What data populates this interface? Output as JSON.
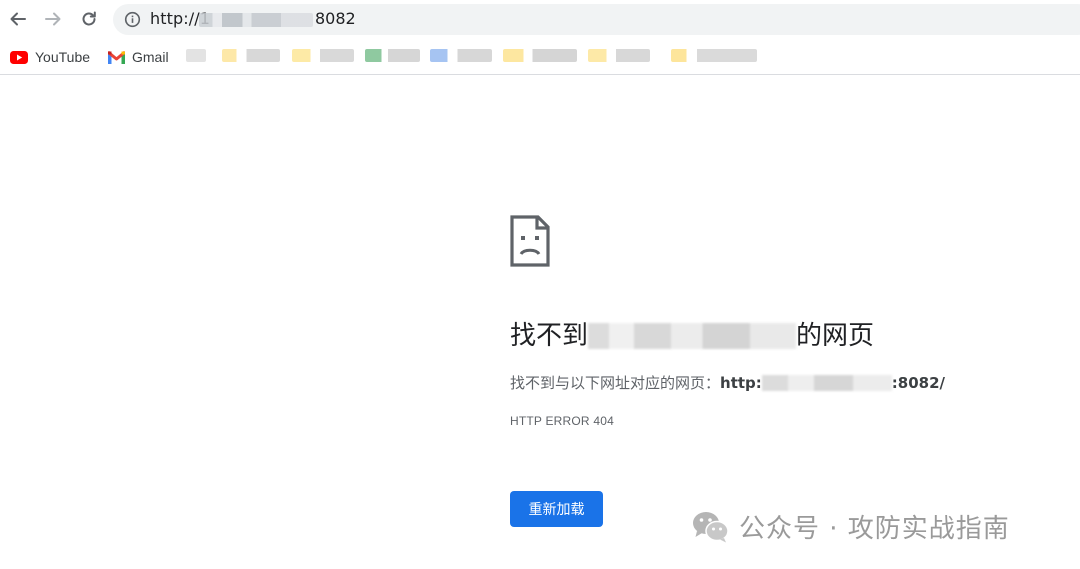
{
  "browser": {
    "url_prefix": "http://1",
    "url_suffix": "8082",
    "bookmarks": [
      {
        "label": "YouTube",
        "icon": "youtube-icon"
      },
      {
        "label": "Gmail",
        "icon": "gmail-icon"
      }
    ]
  },
  "error_page": {
    "title_start": "找不到",
    "title_end": "的网页",
    "desc_prefix": "找不到与以下网址对应的网页：",
    "desc_url_start": "http:",
    "desc_url_end": ":8082/",
    "error_code": "HTTP ERROR 404",
    "reload_label": "重新加载"
  },
  "watermark": {
    "text": "公众号 · 攻防实战指南"
  },
  "colors": {
    "accent": "#1a73e8",
    "omnibox_bg": "#f1f3f4",
    "youtube_red": "#ff0000"
  }
}
